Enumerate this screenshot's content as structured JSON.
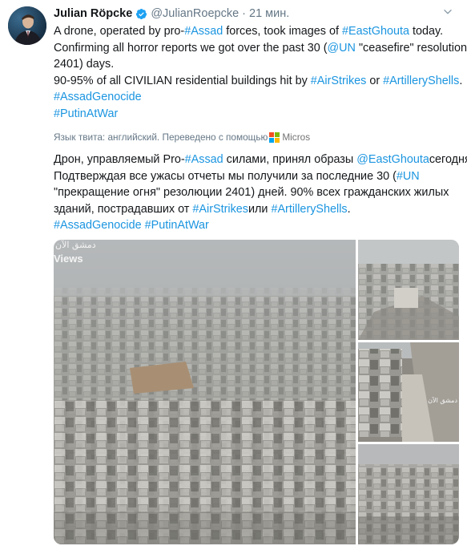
{
  "tweet": {
    "author_name": "Julian Röpcke",
    "author_handle": "@JulianRoepcke",
    "separator": "·",
    "time_ago": "21 мин.",
    "lines": [
      [
        {
          "t": "A drone, operated by pro-"
        },
        {
          "t": "#Assad",
          "link": true
        },
        {
          "t": " forces, took images of "
        },
        {
          "t": "#EastGhouta",
          "link": true
        },
        {
          "t": " today."
        }
      ],
      [
        {
          "t": "Confirming all horror reports we got over the past 30 ("
        },
        {
          "t": "@UN",
          "link": true
        },
        {
          "t": " \"ceasefire\" resolution"
        }
      ],
      [
        {
          "t": "2401) days."
        }
      ],
      [
        {
          "t": "90-95% of all CIVILIAN residential buildings hit by "
        },
        {
          "t": "#AirStrikes",
          "link": true
        },
        {
          "t": " or "
        },
        {
          "t": "#ArtilleryShells",
          "link": true
        },
        {
          "t": "."
        }
      ],
      [
        {
          "t": "#AssadGenocide",
          "link": true
        }
      ],
      [
        {
          "t": "#PutinAtWar",
          "link": true
        }
      ]
    ],
    "translation_label": "Язык твита: английский. Переведено с помощью",
    "translator_name": "Micros",
    "translated_lines": [
      [
        {
          "t": "Дрон, управляемый Pro-"
        },
        {
          "t": "#Assad",
          "link": true
        },
        {
          "t": " силами, принял образы "
        },
        {
          "t": "@EastGhouta",
          "link": true
        },
        {
          "t": "сегодня."
        }
      ],
      [
        {
          "t": "Подтверждая все ужасы отчеты мы получили за последние 30 ("
        },
        {
          "t": "#UN",
          "link": true
        }
      ],
      [
        {
          "t": "\"прекращение огня\" резолюции 2401) дней. 90% всех гражданских жилых"
        }
      ],
      [
        {
          "t": "зданий, пострадавших от "
        },
        {
          "t": "#AirStrikes",
          "link": true
        },
        {
          "t": "или "
        },
        {
          "t": "#ArtilleryShells",
          "link": true
        },
        {
          "t": "."
        }
      ],
      [
        {
          "t": "#AssadGenocide",
          "link": true
        },
        {
          "t": " "
        },
        {
          "t": "#PutinAtWar",
          "link": true
        }
      ]
    ],
    "media": {
      "main_overlay_views": "Views",
      "main_overlay_arabic": "دمشق الآن",
      "small2_overlay_arabic": "دمشق الآن"
    }
  },
  "colors": {
    "link": "#1b95e0",
    "muted": "#657786",
    "verified": "#1da1f2",
    "ms_red": "#f25022",
    "ms_green": "#7fba00",
    "ms_blue": "#00a4ef",
    "ms_yellow": "#ffb900"
  },
  "icons": [
    "verified-badge-icon",
    "chevron-down-icon",
    "microsoft-logo-icon"
  ]
}
